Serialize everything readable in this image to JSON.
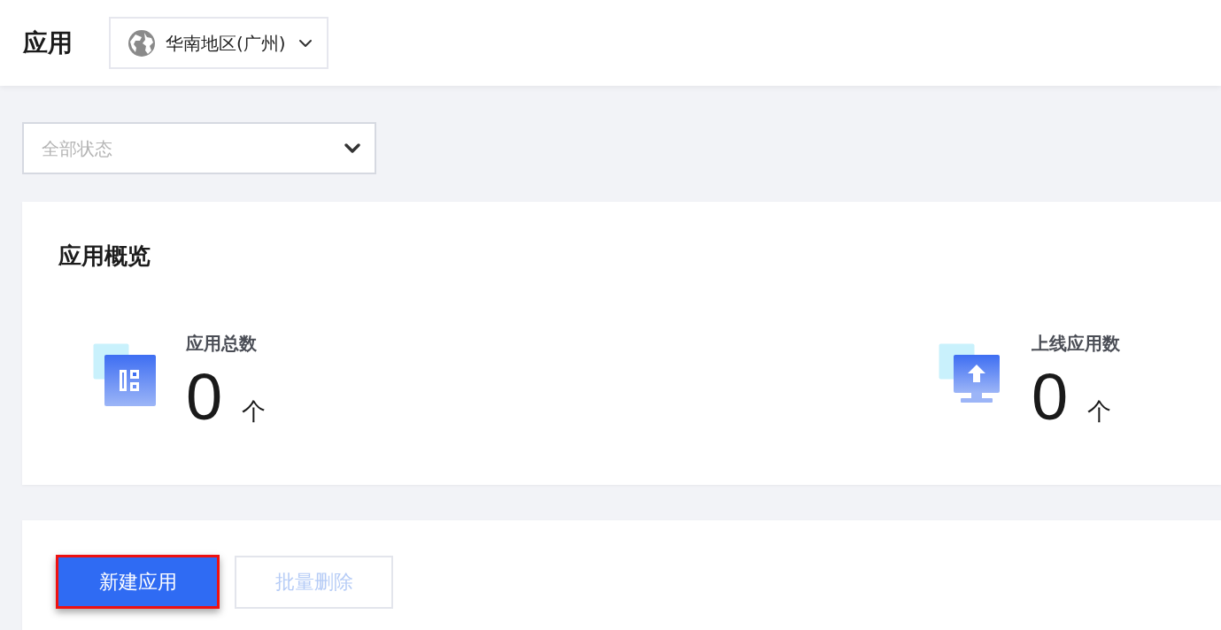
{
  "header": {
    "title": "应用",
    "region_select": {
      "value": "华南地区(广州)"
    }
  },
  "status_filter": {
    "placeholder": "全部状态"
  },
  "overview": {
    "title": "应用概览",
    "stats": [
      {
        "kind": "total",
        "label": "应用总数",
        "value": "0",
        "unit": "个"
      },
      {
        "kind": "online",
        "label": "上线应用数",
        "value": "0",
        "unit": "个"
      }
    ]
  },
  "actions": {
    "buttons": [
      {
        "label": "新建应用",
        "kind": "primary",
        "disabled": false,
        "highlighted": true
      },
      {
        "label": "批量删除",
        "kind": "default",
        "disabled": true,
        "highlighted": false
      }
    ]
  }
}
